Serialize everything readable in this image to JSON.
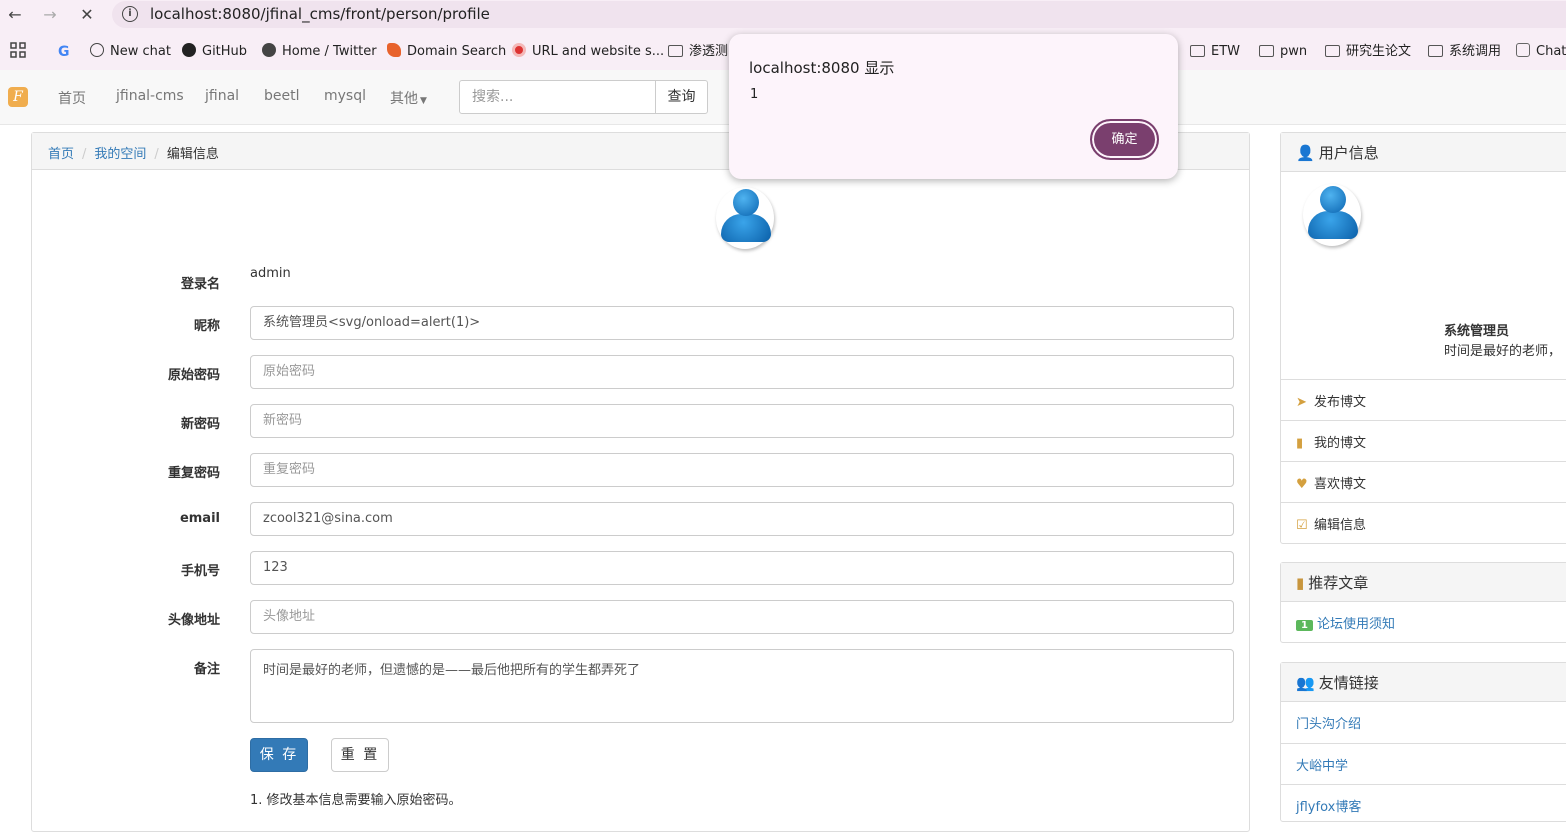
{
  "browser": {
    "url": "localhost:8080/jfinal_cms/front/person/profile",
    "bookmarks": [
      {
        "label": "New chat",
        "icon": "openai-icon"
      },
      {
        "label": "GitHub",
        "icon": "github-icon"
      },
      {
        "label": "Home / Twitter",
        "icon": "globe-icon"
      },
      {
        "label": "Domain Search",
        "icon": "fox-icon"
      },
      {
        "label": "URL and website s...",
        "icon": "scan-icon"
      },
      {
        "label": "渗透测",
        "icon": "folder-icon"
      },
      {
        "label": "ETW",
        "icon": "folder-icon"
      },
      {
        "label": "pwn",
        "icon": "folder-icon"
      },
      {
        "label": "研究生论文",
        "icon": "folder-icon"
      },
      {
        "label": "系统调用",
        "icon": "folder-icon"
      },
      {
        "label": "Chat",
        "icon": "bot-icon"
      }
    ]
  },
  "navbar": {
    "logo": "F",
    "items": [
      "首页",
      "jfinal-cms",
      "jfinal",
      "beetl",
      "mysql",
      "其他"
    ],
    "search_placeholder": "搜索...",
    "search_button": "查询"
  },
  "breadcrumb": {
    "home": "首页",
    "space": "我的空间",
    "current": "编辑信息"
  },
  "form": {
    "login_label": "登录名",
    "login_value": "admin",
    "nickname_label": "昵称",
    "nickname_value": "系统管理员<svg/onload=alert(1)>",
    "old_pwd_label": "原始密码",
    "old_pwd_placeholder": "原始密码",
    "new_pwd_label": "新密码",
    "new_pwd_placeholder": "新密码",
    "repeat_pwd_label": "重复密码",
    "repeat_pwd_placeholder": "重复密码",
    "email_label": "email",
    "email_value": "zcool321@sina.com",
    "phone_label": "手机号",
    "phone_value": "123",
    "avatar_label": "头像地址",
    "avatar_placeholder": "头像地址",
    "remark_label": "备注",
    "remark_value": "时间是最好的老师，但遗憾的是——最后他把所有的学生都弄死了",
    "save_label": "保 存",
    "reset_label": "重 置",
    "note": "1. 修改基本信息需要输入原始密码。"
  },
  "sidebar": {
    "user_title": "用户信息",
    "user_name": "系统管理员",
    "user_motto": "时间是最好的老师，",
    "menu": [
      "发布博文",
      "我的博文",
      "喜欢博文",
      "编辑信息"
    ],
    "recommend_title": "推荐文章",
    "recommend_badge": "1",
    "recommend_item": "论坛使用须知",
    "links_title": "友情链接",
    "links": [
      "门头沟介绍",
      "大峪中学",
      "jflyfox博客"
    ]
  },
  "dialog": {
    "title": "localhost:8080 显示",
    "message": "1",
    "ok_label": "确定"
  }
}
